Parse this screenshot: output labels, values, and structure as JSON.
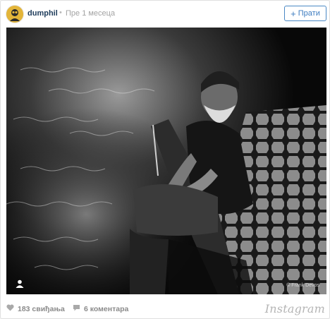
{
  "header": {
    "username": "dumphil",
    "separator": "•",
    "time_ago": "Пре 1 месеца",
    "follow_label": "Прати",
    "follow_icon": "plus-icon"
  },
  "photo": {
    "credit": "© Frank Devos",
    "user_tag_icon": "user-icon"
  },
  "footer": {
    "likes": "183 свиђања",
    "comments": "6 коментара",
    "brand": "Instagram"
  },
  "colors": {
    "follow_accent": "#3d7cc0",
    "username": "#1d3b5a",
    "avatar_bg": "#e3b53a"
  }
}
